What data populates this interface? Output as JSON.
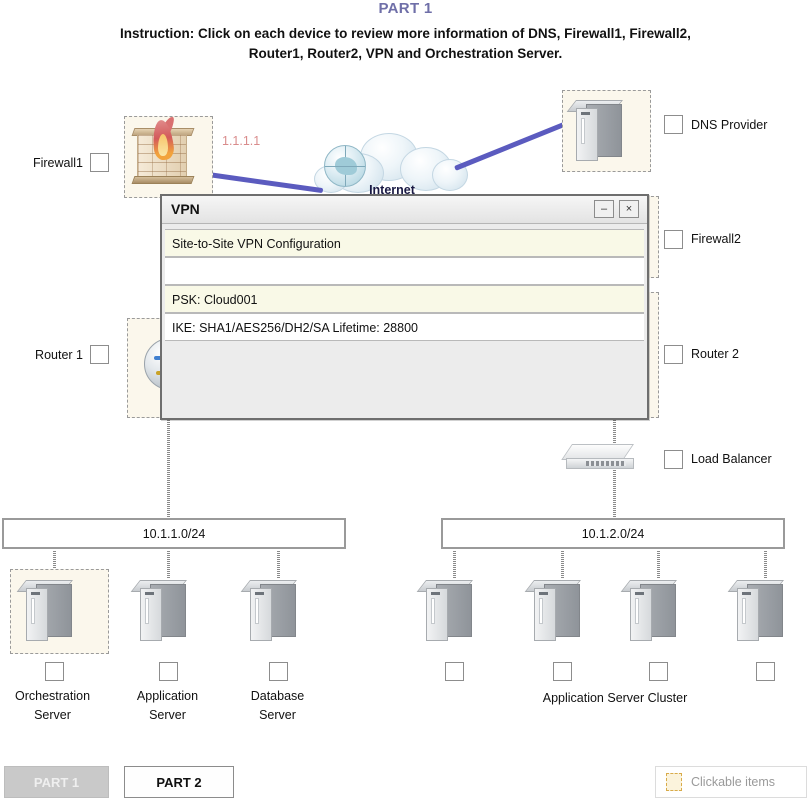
{
  "header": {
    "part_title": "PART 1",
    "instruction_line1": "Instruction: Click on each device to review more information of DNS, Firewall1, Firewall2,",
    "instruction_line2": "Router1, Router2, VPN and Orchestration Server."
  },
  "colors": {
    "title_purple": "#6f6fa8",
    "link_blue": "#5b5bbf",
    "hotspot_fill": "#fbf7ec",
    "hotspot_border": "#9a9a9a",
    "row_cream": "#f9f9e7",
    "ip_label": "#d98c8c"
  },
  "diagram": {
    "firewall1_label": "Firewall1",
    "firewall1_ip": "1.1.1.1",
    "dns_label": "DNS Provider",
    "firewall2_label": "Firewall2",
    "router1_label": "Router 1",
    "router2_label": "Router 2",
    "load_balancer_label": "Load Balancer",
    "internet_label": "Internet",
    "subnet_left": "10.1.1.0/24",
    "subnet_right": "10.1.2.0/24",
    "servers_left": [
      {
        "name": "orchestration-server",
        "line1": "Orchestration",
        "line2": "Server"
      },
      {
        "name": "application-server",
        "line1": "Application",
        "line2": "Server"
      },
      {
        "name": "database-server",
        "line1": "Database",
        "line2": "Server"
      }
    ],
    "cluster_label": "Application Server Cluster",
    "cluster_count": 4
  },
  "dialog": {
    "title": "VPN",
    "minimize_label": "–",
    "close_label": "×",
    "rows": [
      {
        "text": "Site-to-Site VPN Configuration",
        "style": "cream"
      },
      {
        "text": "",
        "style": "white"
      },
      {
        "text": "PSK: Cloud001",
        "style": "cream"
      },
      {
        "text": "IKE: SHA1/AES256/DH2/SA Lifetime: 28800",
        "style": "white"
      }
    ]
  },
  "footer": {
    "part1_label": "PART 1",
    "part2_label": "PART 2",
    "legend_label": "Clickable items"
  }
}
